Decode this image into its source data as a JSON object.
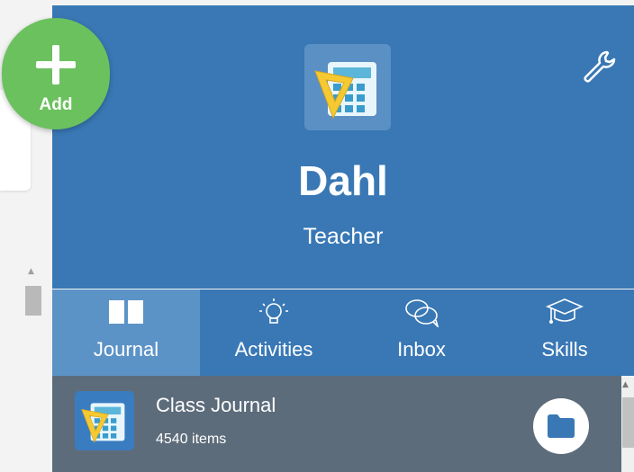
{
  "fab": {
    "label": "Add",
    "icon": "plus-icon",
    "color": "#6bc15e"
  },
  "profile": {
    "name": "Dahl",
    "role": "Teacher",
    "background_color": "#3978b5",
    "avatar_icon": "calculator-ruler-icon",
    "settings_icon": "wrench-icon"
  },
  "tabs": [
    {
      "label": "Journal",
      "icon": "book-icon",
      "active": true
    },
    {
      "label": "Activities",
      "icon": "lightbulb-icon",
      "active": false
    },
    {
      "label": "Inbox",
      "icon": "chat-bubbles-icon",
      "active": false
    },
    {
      "label": "Skills",
      "icon": "graduation-cap-icon",
      "active": false
    }
  ],
  "journals": [
    {
      "title": "Class Journal",
      "count": "4540 items",
      "icon": "calculator-ruler-icon",
      "action_icon": "folder-icon"
    }
  ]
}
